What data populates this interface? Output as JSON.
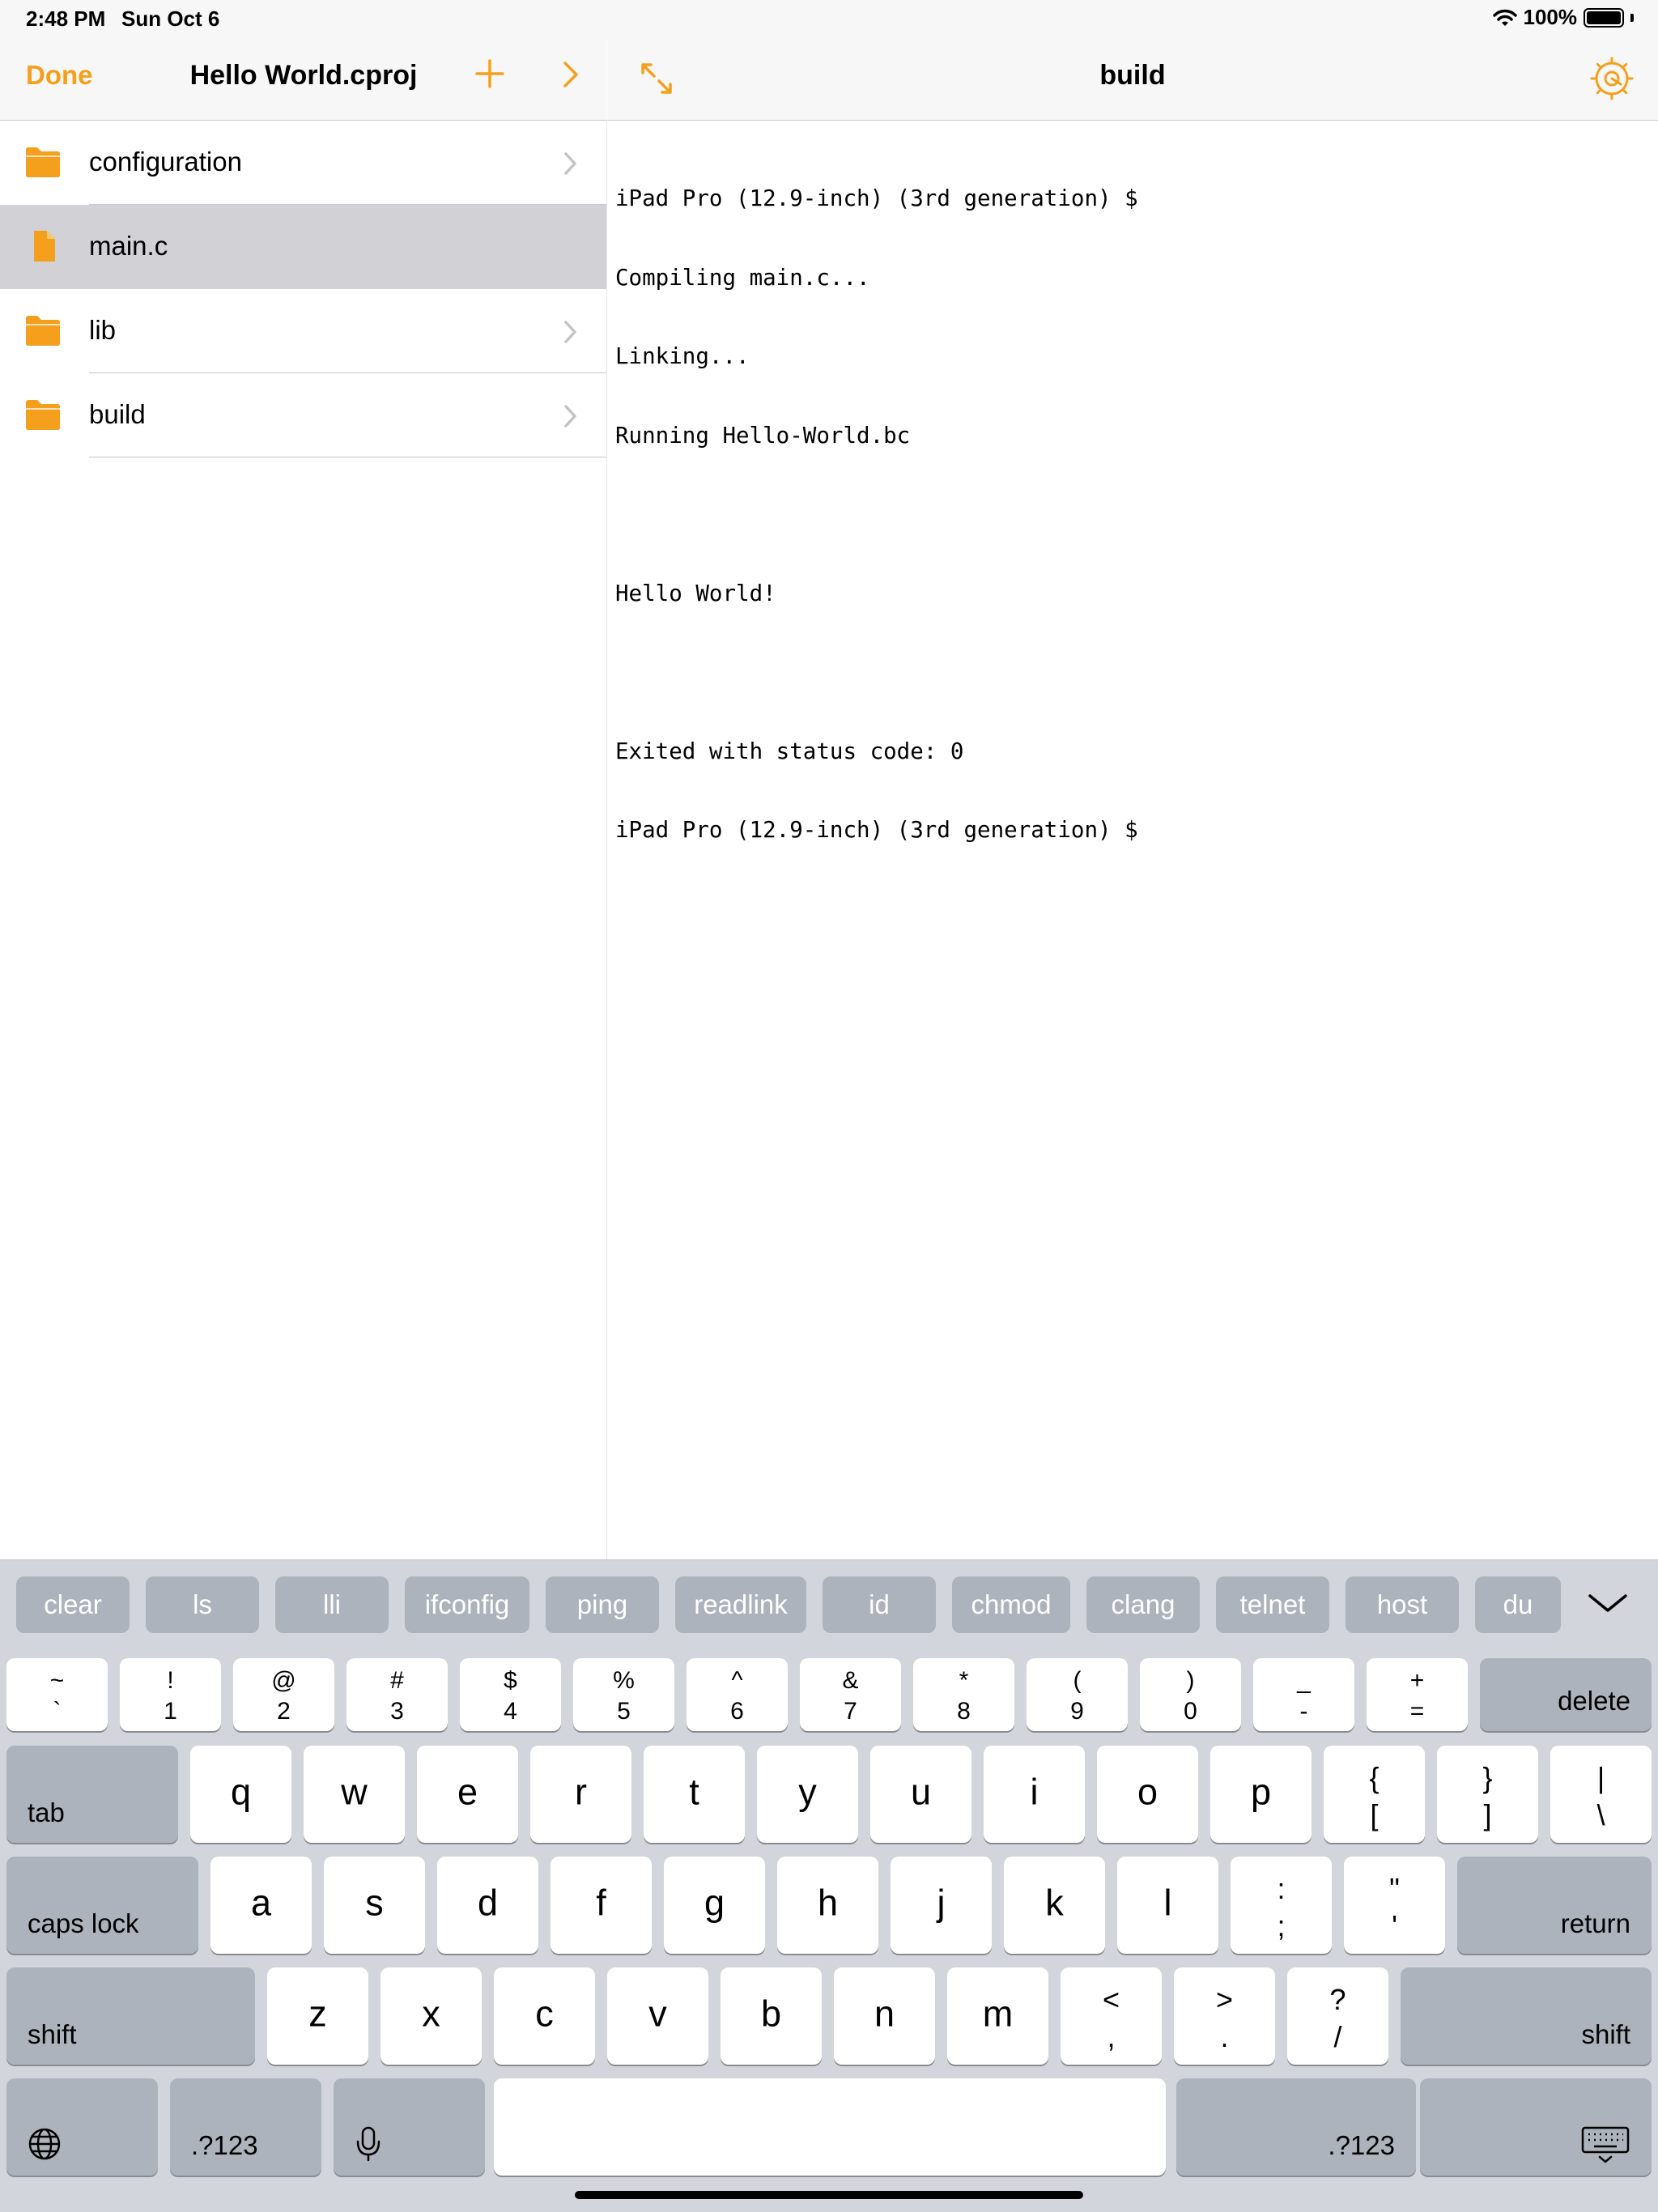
{
  "status_bar": {
    "time": "2:48 PM",
    "date": "Sun Oct 6",
    "battery": "100%",
    "wifi_icon": "wifi-icon",
    "battery_icon": "battery-icon"
  },
  "left_nav": {
    "done_label": "Done",
    "title": "Hello World.cproj",
    "plus_icon": "plus-icon",
    "forward_icon": "chevron-right-icon"
  },
  "right_nav": {
    "title": "build",
    "expand_icon": "expand-arrows-icon",
    "settings_icon": "gear-icon"
  },
  "files": [
    {
      "name": "configuration",
      "type": "folder",
      "selected": false
    },
    {
      "name": "main.c",
      "type": "file",
      "selected": true
    },
    {
      "name": "lib",
      "type": "folder",
      "selected": false
    },
    {
      "name": "build",
      "type": "folder",
      "selected": false
    }
  ],
  "terminal": {
    "lines": [
      "iPad Pro (12.9-inch) (3rd generation) $",
      "Compiling main.c...",
      "Linking...",
      "Running Hello-World.bc",
      "",
      "Hello World!",
      "",
      "Exited with status code: 0",
      "iPad Pro (12.9-inch) (3rd generation) $"
    ]
  },
  "keyboard": {
    "suggestions": [
      "clear",
      "ls",
      "lli",
      "ifconfig",
      "ping",
      "readlink",
      "id",
      "chmod",
      "clang",
      "telnet",
      "host",
      "du"
    ],
    "dismiss_icon": "chevron-down-icon",
    "number_row": [
      {
        "top": "~",
        "bottom": "`"
      },
      {
        "top": "!",
        "bottom": "1"
      },
      {
        "top": "@",
        "bottom": "2"
      },
      {
        "top": "#",
        "bottom": "3"
      },
      {
        "top": "$",
        "bottom": "4"
      },
      {
        "top": "%",
        "bottom": "5"
      },
      {
        "top": "^",
        "bottom": "6"
      },
      {
        "top": "&",
        "bottom": "7"
      },
      {
        "top": "*",
        "bottom": "8"
      },
      {
        "top": "(",
        "bottom": "9"
      },
      {
        "top": ")",
        "bottom": "0"
      },
      {
        "top": "_",
        "bottom": "-"
      },
      {
        "top": "+",
        "bottom": "="
      }
    ],
    "delete_label": "delete",
    "tab_label": "tab",
    "row_q": [
      "q",
      "w",
      "e",
      "r",
      "t",
      "y",
      "u",
      "i",
      "o",
      "p"
    ],
    "row_q_symbols": [
      {
        "top": "{",
        "bottom": "["
      },
      {
        "top": "}",
        "bottom": "]"
      },
      {
        "top": "|",
        "bottom": "\\"
      }
    ],
    "caps_label": "caps lock",
    "row_a": [
      "a",
      "s",
      "d",
      "f",
      "g",
      "h",
      "j",
      "k",
      "l"
    ],
    "row_a_symbols": [
      {
        "top": ":",
        "bottom": ";"
      },
      {
        "top": "\"",
        "bottom": "'"
      }
    ],
    "return_label": "return",
    "shift_label": "shift",
    "row_z": [
      "z",
      "x",
      "c",
      "v",
      "b",
      "n",
      "m"
    ],
    "row_z_symbols": [
      {
        "top": "<",
        "bottom": ","
      },
      {
        "top": ">",
        "bottom": "."
      },
      {
        "top": "?",
        "bottom": "/"
      }
    ],
    "numbers_label": ".?123",
    "globe_icon": "globe-icon",
    "mic_icon": "microphone-icon",
    "hide_keyboard_icon": "keyboard-hide-icon"
  }
}
